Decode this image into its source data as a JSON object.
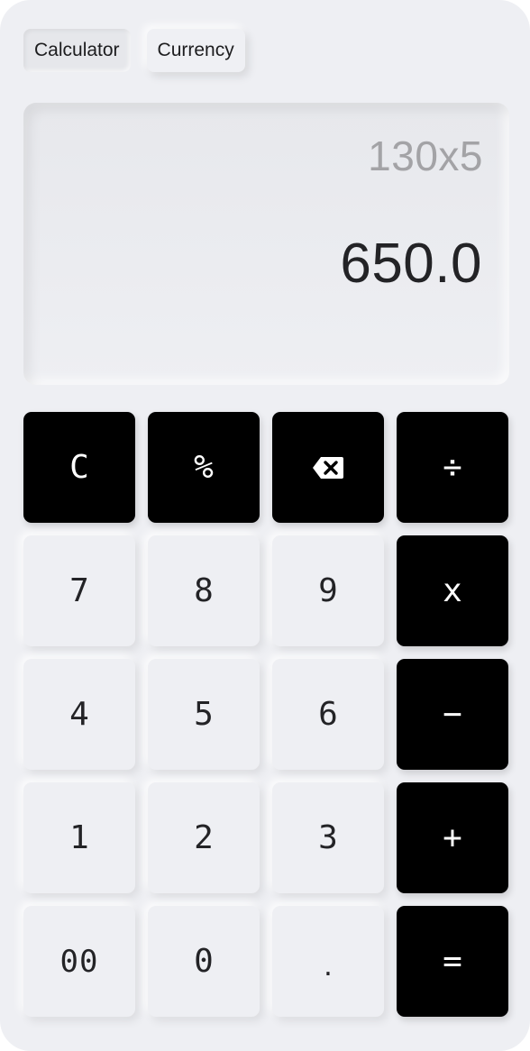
{
  "tabs": [
    {
      "label": "Calculator",
      "active": true
    },
    {
      "label": "Currency",
      "active": false
    }
  ],
  "display": {
    "expression": "130x5",
    "result": "650.0"
  },
  "keys": {
    "clear": "C",
    "percent": "%",
    "backspace_icon": "backspace-icon",
    "divide": "÷",
    "seven": "7",
    "eight": "8",
    "nine": "9",
    "multiply": "x",
    "four": "4",
    "five": "5",
    "six": "6",
    "minus": "−",
    "one": "1",
    "two": "2",
    "three": "3",
    "plus": "+",
    "double_zero": "00",
    "zero": "0",
    "decimal": ".",
    "equals": "="
  },
  "colors": {
    "background": "#eeeff3",
    "operator_key": "#000000",
    "operator_text": "#ffffff",
    "digit_text": "#232326",
    "expression_text": "#a3a3a6"
  }
}
